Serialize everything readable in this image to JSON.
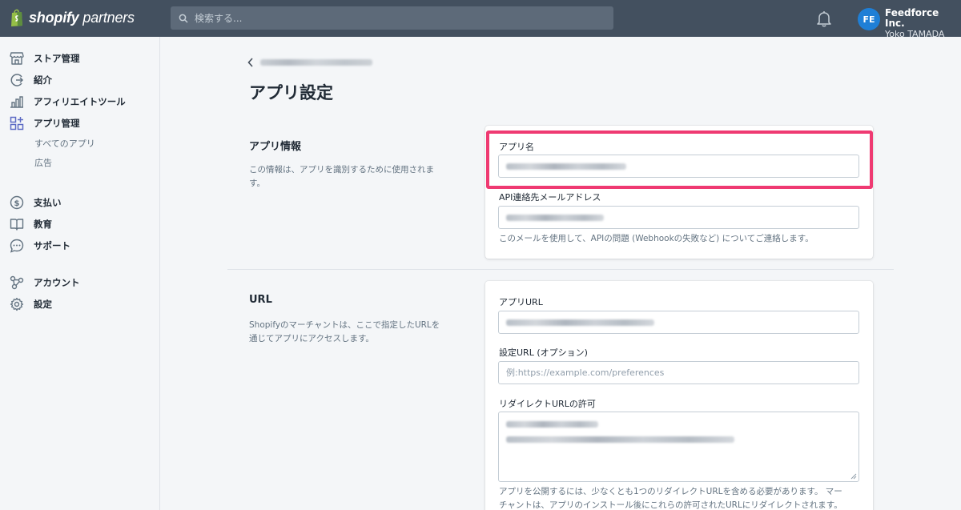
{
  "brand": {
    "bold": "shopify",
    "rest": " partners"
  },
  "search": {
    "placeholder": "検索する..."
  },
  "account": {
    "initials": "FE",
    "org": "Feedforce Inc.",
    "user": "Yoko TAMADA"
  },
  "sidebar": {
    "items": [
      {
        "label": "ストア管理",
        "icon": "store-icon"
      },
      {
        "label": "紹介",
        "icon": "referral-icon"
      },
      {
        "label": "アフィリエイトツール",
        "icon": "chart-icon"
      },
      {
        "label": "アプリ管理",
        "icon": "apps-icon"
      },
      {
        "label": "支払い",
        "icon": "dollar-icon"
      },
      {
        "label": "教育",
        "icon": "book-icon"
      },
      {
        "label": "サポート",
        "icon": "chat-icon"
      },
      {
        "label": "アカウント",
        "icon": "account-icon"
      },
      {
        "label": "設定",
        "icon": "gear-icon"
      }
    ],
    "subitems": [
      {
        "label": "すべてのアプリ"
      },
      {
        "label": "広告"
      }
    ]
  },
  "page": {
    "title": "アプリ設定"
  },
  "app_info": {
    "title": "アプリ情報",
    "description": "この情報は、アプリを識別するために使用されます。",
    "app_name_label": "アプリ名",
    "email_label": "API連絡先メールアドレス",
    "email_help": "このメールを使用して、APIの問題 (Webhookの失敗など) についてご連絡します。"
  },
  "url_section": {
    "title": "URL",
    "description": "Shopifyのマーチャントは、ここで指定したURLを通じてアプリにアクセスします。",
    "app_url_label": "アプリURL",
    "settings_url_label": "設定URL (オプション)",
    "settings_url_placeholder": "例:https://example.com/preferences",
    "redirect_label": "リダイレクトURLの許可",
    "redirect_help_1": "アプリを公開するには、少なくとも1つのリダイレクトURLを含める必要があります。 マー",
    "redirect_help_2": "チャントは、アプリのインストール後にこれらの許可されたURLにリダイレクトされます。"
  },
  "colors": {
    "topbar": "#43505f",
    "highlight": "#ef3a72",
    "avatar": "#1f7fd6"
  }
}
